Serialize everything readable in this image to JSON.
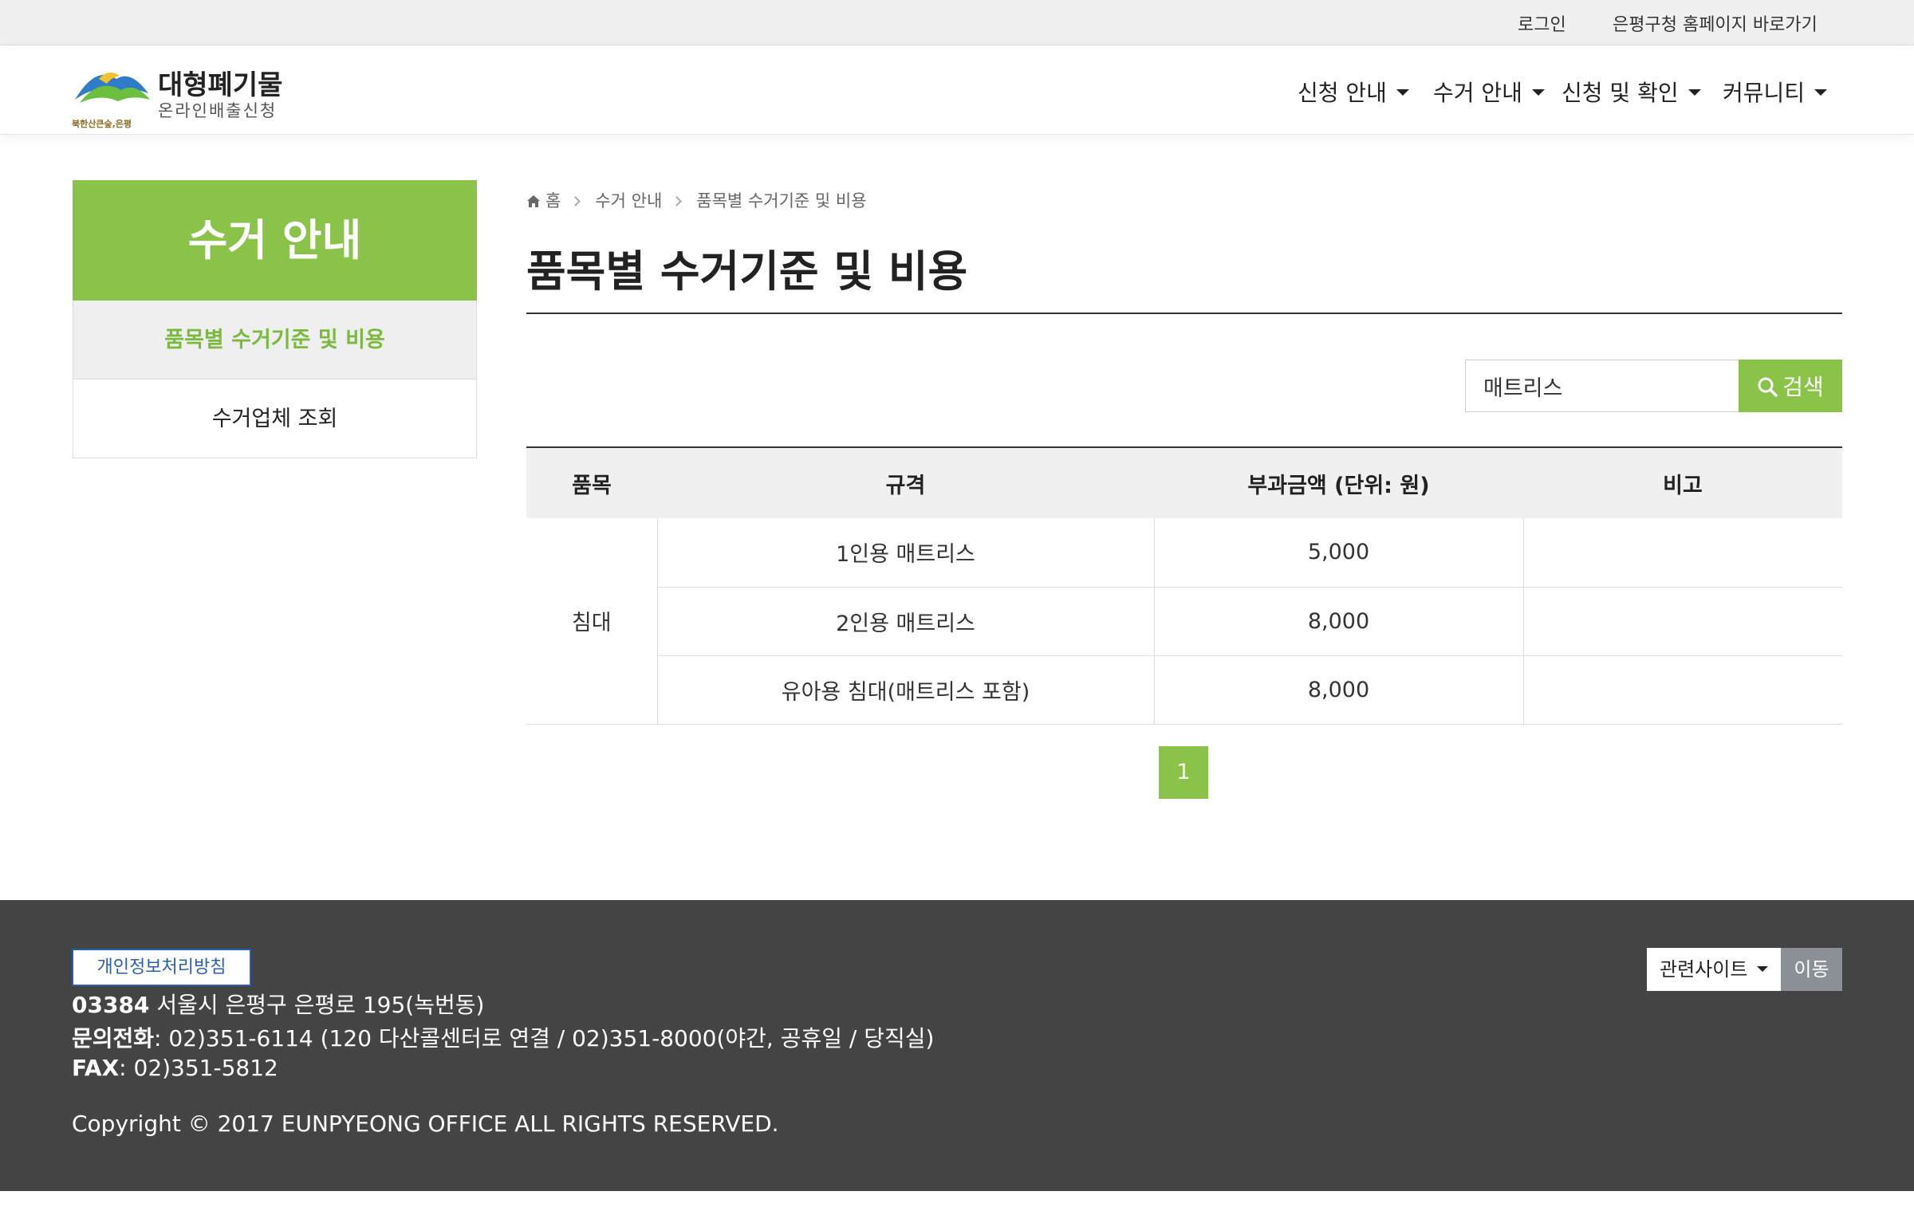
{
  "util": {
    "login": "로그인",
    "home_link": "은평구청 홈페이지 바로가기"
  },
  "logo": {
    "title": "대형폐기물",
    "subtitle": "온라인배출신청",
    "slogan": "북한산큰숲,은평"
  },
  "nav": [
    {
      "label": "신청 안내"
    },
    {
      "label": "수거 안내"
    },
    {
      "label": "신청 및 확인"
    },
    {
      "label": "커뮤니티"
    }
  ],
  "sidebar": {
    "title": "수거 안내",
    "items": [
      {
        "label": "품목별 수거기준 및 비용",
        "active": true
      },
      {
        "label": "수거업체 조회",
        "active": false
      }
    ]
  },
  "breadcrumb": {
    "home": "홈",
    "level1": "수거 안내",
    "level2": "품목별 수거기준 및 비용"
  },
  "page_title": "품목별 수거기준 및 비용",
  "search": {
    "value": "매트리스",
    "button": "검색"
  },
  "table": {
    "headers": [
      "품목",
      "규격",
      "부과금액 (단위: 원)",
      "비고"
    ],
    "category": "침대",
    "rows": [
      {
        "spec": "1인용 매트리스",
        "price": "5,000",
        "note": ""
      },
      {
        "spec": "2인용 매트리스",
        "price": "8,000",
        "note": ""
      },
      {
        "spec": "유아용 침대(매트리스 포함)",
        "price": "8,000",
        "note": ""
      }
    ]
  },
  "pagination": {
    "current": "1"
  },
  "footer": {
    "privacy": "개인정보처리방침",
    "zip": "03384",
    "address": " 서울시 은평구 은평로 195(녹번동)",
    "phone_label": "문의전화",
    "phone": ": 02)351-6114 (120 다산콜센터로 연결 / 02)351-8000(야간, 공휴일 / 당직실)",
    "fax_label": "FAX",
    "fax": ": 02)351-5812",
    "copyright": "Copyright © 2017 EUNPYEONG OFFICE ALL RIGHTS RESERVED.",
    "related_label": "관련사이트",
    "go_label": "이동"
  },
  "colors": {
    "accent": "#8bc34a",
    "footer_bg": "#444444",
    "privacy_border": "#2a5fb0"
  }
}
